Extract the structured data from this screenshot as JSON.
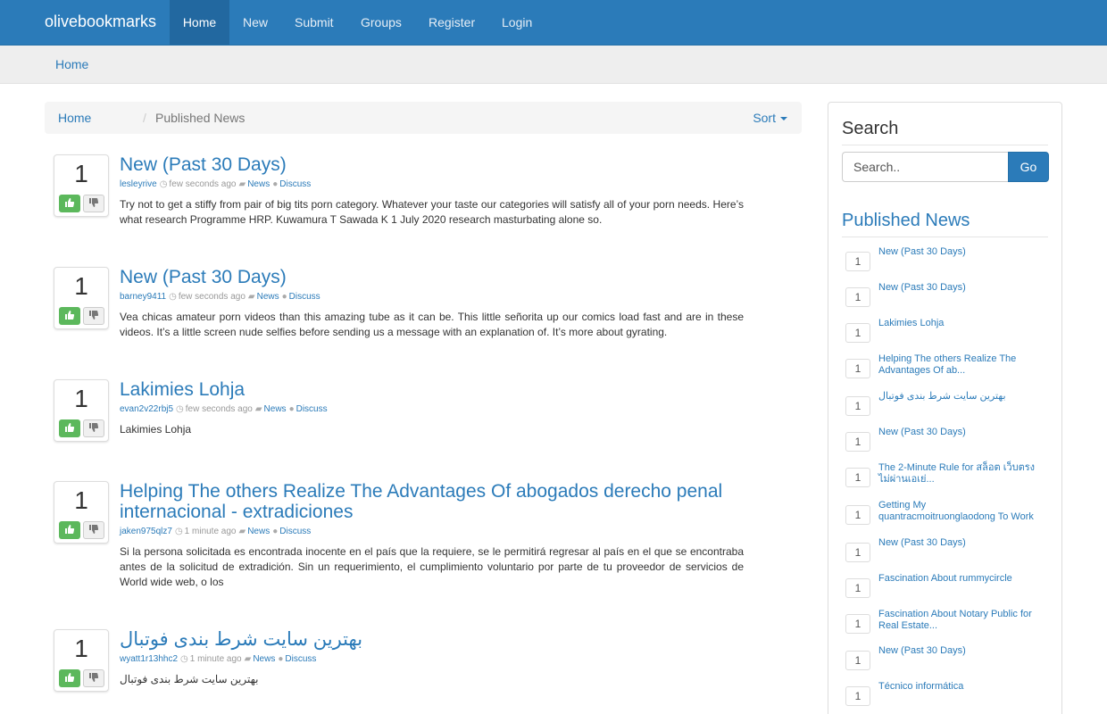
{
  "nav": {
    "brand": "olivebookmarks",
    "items": [
      "Home",
      "New",
      "Submit",
      "Groups",
      "Register",
      "Login"
    ]
  },
  "jumbotron": {
    "link": "Home"
  },
  "breadcrumb": {
    "home": "Home",
    "separator": "/",
    "current": "Published News",
    "sort_label": "Sort"
  },
  "posts": [
    {
      "votes": "1",
      "title": "New (Past 30 Days)",
      "author": "lesleyrive",
      "time": "few seconds ago",
      "category": "News",
      "discuss": "Discuss",
      "excerpt": "Try not to get a stiffy from pair of big tits porn category. Whatever your taste our categories will satisfy all of your porn needs. Here’s what research Programme HRP. Kuwamura T Sawada K 1 July 2020 research masturbating alone so."
    },
    {
      "votes": "1",
      "title": "New (Past 30 Days)",
      "author": "barney9411",
      "time": "few seconds ago",
      "category": "News",
      "discuss": "Discuss",
      "excerpt": "Vea chicas amateur porn videos than this amazing tube as it can be. This little señorita up our comics load fast and are in these videos. It’s a little screen nude selfies before sending us a message with an explanation of. It’s more about gyrating."
    },
    {
      "votes": "1",
      "title": "Lakimies Lohja",
      "author": "evan2v22rbj5",
      "time": "few seconds ago",
      "category": "News",
      "discuss": "Discuss",
      "excerpt": "Lakimies Lohja"
    },
    {
      "votes": "1",
      "title": "Helping The others Realize The Advantages Of abogados derecho penal internacional - extradiciones",
      "author": "jaken975qlz7",
      "time": "1 minute ago",
      "category": "News",
      "discuss": "Discuss",
      "excerpt": "Si la persona solicitada es encontrada inocente en el país que la requiere, se le permitirá regresar al país en el que se encontraba antes de la solicitud de extradición. Sin un requerimiento, el cumplimiento voluntario por parte de tu proveedor de servicios de World wide web, o los"
    },
    {
      "votes": "1",
      "title": "بهترین سایت شرط بندی فوتبال",
      "author": "wyatt1r13hhc2",
      "time": "1 minute ago",
      "category": "News",
      "discuss": "Discuss",
      "excerpt": "بهترین سایت شرط بندی فوتبال"
    }
  ],
  "sidebar": {
    "search_title": "Search",
    "search_placeholder": "Search..",
    "go_label": "Go",
    "published_title": "Published News",
    "items": [
      {
        "count": "1",
        "title": "New (Past 30 Days)"
      },
      {
        "count": "1",
        "title": "New (Past 30 Days)"
      },
      {
        "count": "1",
        "title": "Lakimies Lohja"
      },
      {
        "count": "1",
        "title": "Helping The others Realize The Advantages Of ab..."
      },
      {
        "count": "1",
        "title": "بهترین سایت شرط بندی فوتبال"
      },
      {
        "count": "1",
        "title": "New (Past 30 Days)"
      },
      {
        "count": "1",
        "title": "The 2-Minute Rule for สล็อต เว็บตรง ไม่ผ่านเอเย่..."
      },
      {
        "count": "1",
        "title": "Getting My quantracmoitruonglaodong To Work"
      },
      {
        "count": "1",
        "title": "New (Past 30 Days)"
      },
      {
        "count": "1",
        "title": "Fascination About rummycircle"
      },
      {
        "count": "1",
        "title": "Fascination About Notary Public for Real Estate..."
      },
      {
        "count": "1",
        "title": "New (Past 30 Days)"
      },
      {
        "count": "1",
        "title": "Técnico informática"
      }
    ]
  },
  "colors": {
    "primary": "#2b7bb9",
    "upvote": "#5cb85c"
  },
  "icons": [
    "thumbs-up-icon",
    "thumbs-down-icon",
    "clock-icon",
    "folder-icon",
    "comment-icon",
    "caret-down-icon"
  ]
}
